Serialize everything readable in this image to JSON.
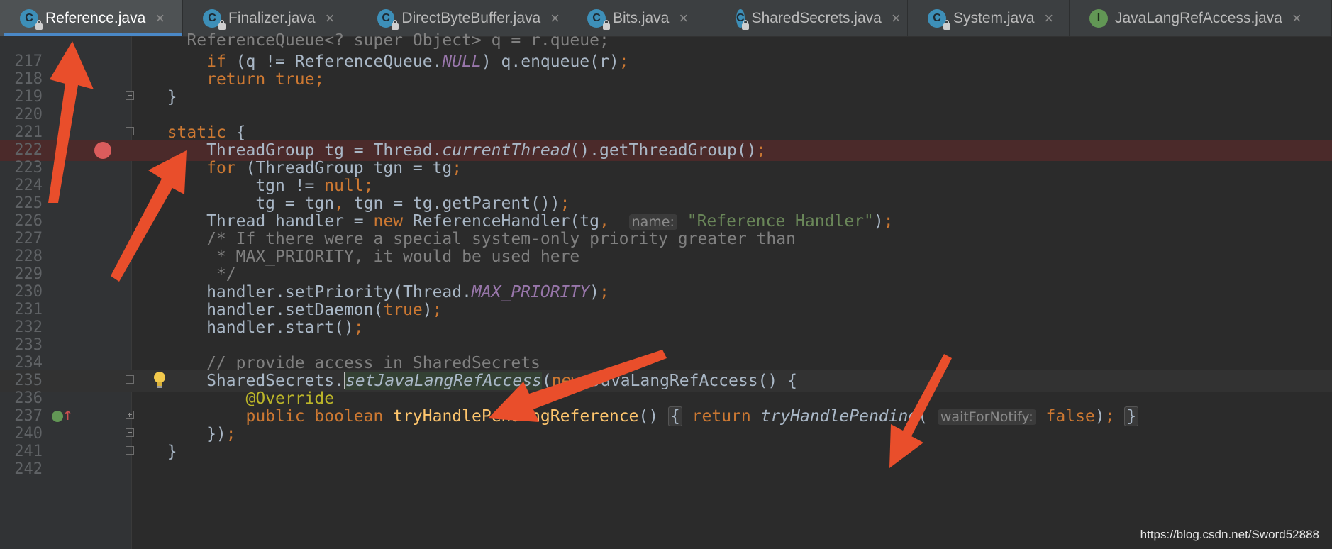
{
  "tabs": [
    {
      "label": "Reference.java",
      "icon": "class-icon",
      "active": true
    },
    {
      "label": "Finalizer.java",
      "icon": "class-icon"
    },
    {
      "label": "DirectByteBuffer.java",
      "icon": "class-icon"
    },
    {
      "label": "Bits.java",
      "icon": "class-icon"
    },
    {
      "label": "SharedSecrets.java",
      "icon": "class-icon"
    },
    {
      "label": "System.java",
      "icon": "class-icon"
    },
    {
      "label": "JavaLangRefAccess.java",
      "icon": "interface-icon"
    }
  ],
  "tab_glyph_class": "C",
  "tab_glyph_interface": "I",
  "tab_close_glyph": "×",
  "line_numbers": [
    "217",
    "218",
    "219",
    "220",
    "221",
    "222",
    "223",
    "224",
    "225",
    "226",
    "227",
    "228",
    "229",
    "230",
    "231",
    "232",
    "233",
    "234",
    "235",
    "236",
    "237",
    "240",
    "241",
    "242"
  ],
  "hints": {
    "name": "name:",
    "waitForNotify": "waitForNotify:"
  },
  "watermark": "https://blog.csdn.net/Sword52888",
  "colors": {
    "keyword": "#cc7832",
    "string": "#6a8759",
    "comment": "#808080",
    "constant": "#9876aa",
    "method_decl": "#ffc66d",
    "annotation": "#bbb529",
    "breakpoint": "#db5c5c",
    "arrow": "#e94e2b"
  }
}
